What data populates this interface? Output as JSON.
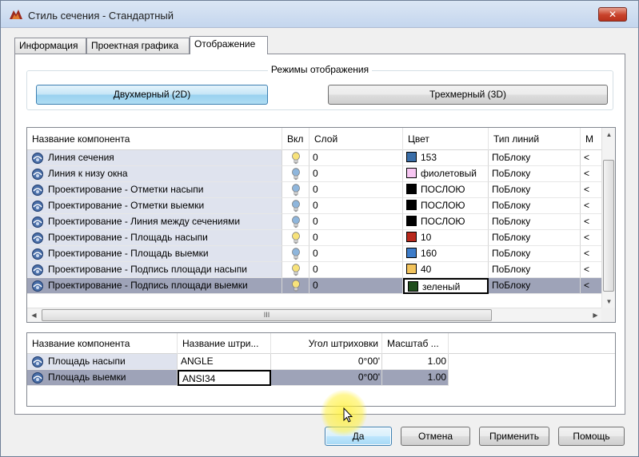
{
  "window": {
    "title": "Стиль сечения - Стандартный",
    "close_label": "✕"
  },
  "tabs": [
    {
      "label": "Информация",
      "active": false
    },
    {
      "label": "Проектная графика",
      "active": false
    },
    {
      "label": "Отображение",
      "active": true
    }
  ],
  "display_modes": {
    "legend": "Режимы отображения",
    "mode_2d": "Двухмерный (2D)",
    "mode_3d": "Трехмерный (3D)",
    "selected": "2D"
  },
  "components_grid": {
    "columns": [
      "Название компонента",
      "Вкл",
      "Слой",
      "Цвет",
      "Тип линий",
      "М"
    ],
    "rows": [
      {
        "name": "Линия сечения",
        "on": true,
        "layer": "0",
        "color": "153",
        "color_hex": "#3a6ea8",
        "linetype": "ПоБлоку",
        "more": "<"
      },
      {
        "name": "Линия к низу окна",
        "on": false,
        "layer": "0",
        "color": "фиолетовый",
        "color_hex": "#f7c6f2",
        "linetype": "ПоБлоку",
        "more": "<"
      },
      {
        "name": "Проектирование - Отметки насыпи",
        "on": false,
        "layer": "0",
        "color": "ПОСЛОЮ",
        "color_hex": "#000000",
        "linetype": "ПоБлоку",
        "more": "<"
      },
      {
        "name": "Проектирование - Отметки выемки",
        "on": false,
        "layer": "0",
        "color": "ПОСЛОЮ",
        "color_hex": "#000000",
        "linetype": "ПоБлоку",
        "more": "<"
      },
      {
        "name": "Проектирование - Линия между сечениями",
        "on": false,
        "layer": "0",
        "color": "ПОСЛОЮ",
        "color_hex": "#000000",
        "linetype": "ПоБлоку",
        "more": "<"
      },
      {
        "name": "Проектирование - Площадь насыпи",
        "on": true,
        "layer": "0",
        "color": "10",
        "color_hex": "#b8281c",
        "linetype": "ПоБлоку",
        "more": "<"
      },
      {
        "name": "Проектирование - Площадь выемки",
        "on": false,
        "layer": "0",
        "color": "160",
        "color_hex": "#3d7cc9",
        "linetype": "ПоБлоку",
        "more": "<"
      },
      {
        "name": "Проектирование - Подпись площади насыпи",
        "on": true,
        "layer": "0",
        "color": "40",
        "color_hex": "#f2c35c",
        "linetype": "ПоБлоку",
        "more": "<"
      },
      {
        "name": "Проектирование - Подпись площади выемки",
        "on": true,
        "layer": "0",
        "color": "зеленый",
        "color_hex": "#1f4d1c",
        "linetype": "ПоБлоку",
        "more": "<",
        "selected": true
      }
    ],
    "hscroll_grip": "III"
  },
  "hatch_grid": {
    "columns": [
      "Название компонента",
      "Название штри...",
      "Угол штриховки",
      "Масштаб ..."
    ],
    "rows": [
      {
        "name": "Площадь насыпи",
        "pattern": "ANGLE",
        "angle": "0°00'",
        "scale": "1.00"
      },
      {
        "name": "Площадь выемки",
        "pattern": "ANSI34",
        "angle": "0°00'",
        "scale": "1.00",
        "selected": true
      }
    ]
  },
  "buttons": {
    "ok": "Да",
    "cancel": "Отмена",
    "apply": "Применить",
    "help": "Помощь"
  },
  "colors": {
    "selected_row": "#9ea3b8",
    "name_column": "#dfe3ee",
    "bulb_on": "#f7e27a",
    "bulb_off": "#8fb6dc"
  }
}
